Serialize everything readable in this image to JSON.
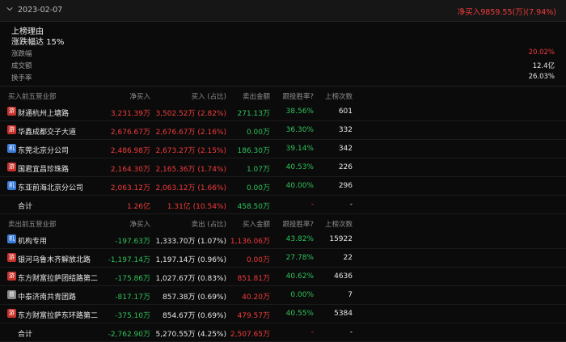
{
  "header": {
    "date": "2023-02-07",
    "net_buy": "净买入9859.55(万)(7.94%)"
  },
  "reason": {
    "title": "上榜理由",
    "text": "涨跌幅达 15%"
  },
  "stats": [
    {
      "label": "涨跌幅",
      "value": "20.02%",
      "red": true
    },
    {
      "label": "成交额",
      "value": "12.4亿",
      "red": false
    },
    {
      "label": "换手率",
      "value": "26.03%",
      "red": false
    }
  ],
  "buy": {
    "headers": [
      "买入前五营业部",
      "净买入",
      "买入 (占比)",
      "卖出金额",
      "跟投胜率?",
      "上榜次数"
    ],
    "rows": [
      {
        "badge": "游",
        "name": "财通杭州上塘路",
        "net": "3,231.39万",
        "amount": "3,502.52万 (2.82%)",
        "other": "271.13万",
        "win": "38.56%",
        "count": "601"
      },
      {
        "badge": "游",
        "name": "华鑫成都交子大道",
        "net": "2,676.67万",
        "amount": "2,676.67万 (2.16%)",
        "other": "0.00万",
        "win": "36.30%",
        "count": "332"
      },
      {
        "badge": "机",
        "name": "东莞北京分公司",
        "net": "2,486.98万",
        "amount": "2,673.27万 (2.15%)",
        "other": "186.30万",
        "win": "39.14%",
        "count": "342"
      },
      {
        "badge": "游",
        "name": "国君宜昌珍珠路",
        "net": "2,164.30万",
        "amount": "2,165.36万 (1.74%)",
        "other": "1.07万",
        "win": "40.53%",
        "count": "226"
      },
      {
        "badge": "机",
        "name": "东亚前海北京分公司",
        "net": "2,063.12万",
        "amount": "2,063.12万 (1.66%)",
        "other": "0.00万",
        "win": "40.00%",
        "count": "296"
      }
    ],
    "total": {
      "label": "合计",
      "net": "1.26亿",
      "amount": "1.31亿 (10.54%)",
      "other": "458.50万",
      "win": "-",
      "count": "-"
    }
  },
  "sell": {
    "headers": [
      "卖出前五营业部",
      "净买入",
      "卖出 (占比)",
      "买入金额",
      "跟投胜率?",
      "上榜次数"
    ],
    "rows": [
      {
        "badge": "机",
        "name": "机构专用",
        "net": "-197.63万",
        "amount": "1,333.70万 (1.07%)",
        "other": "1,136.06万",
        "win": "43.82%",
        "count": "15922"
      },
      {
        "badge": "游",
        "name": "银河乌鲁木齐解放北路",
        "net": "-1,197.14万",
        "amount": "1,197.14万 (0.96%)",
        "other": "0.00万",
        "win": "27.78%",
        "count": "22"
      },
      {
        "badge": "游",
        "name": "东方财富拉萨团结路第二",
        "net": "-175.86万",
        "amount": "1,027.67万 (0.83%)",
        "other": "851.81万",
        "win": "40.62%",
        "count": "4636"
      },
      {
        "badge": "普",
        "name": "中泰济南共青团路",
        "net": "-817.17万",
        "amount": "857.38万 (0.69%)",
        "other": "40.20万",
        "win": "0.00%",
        "count": "7"
      },
      {
        "badge": "游",
        "name": "东方财富拉萨东环路第二",
        "net": "-375.10万",
        "amount": "854.67万 (0.69%)",
        "other": "479.57万",
        "win": "40.55%",
        "count": "5384"
      }
    ],
    "total": {
      "label": "合计",
      "net": "-2,762.90万",
      "amount": "5,270.55万 (4.25%)",
      "other": "2,507.65万",
      "win": "-",
      "count": "-"
    }
  },
  "colors": {
    "up": "#f23b3b",
    "down": "#2fc25b",
    "bg": "#0b0b0b",
    "badge_you": "#c8322c",
    "badge_ji": "#3a7bd5",
    "badge_pu": "#8a8a8a"
  }
}
